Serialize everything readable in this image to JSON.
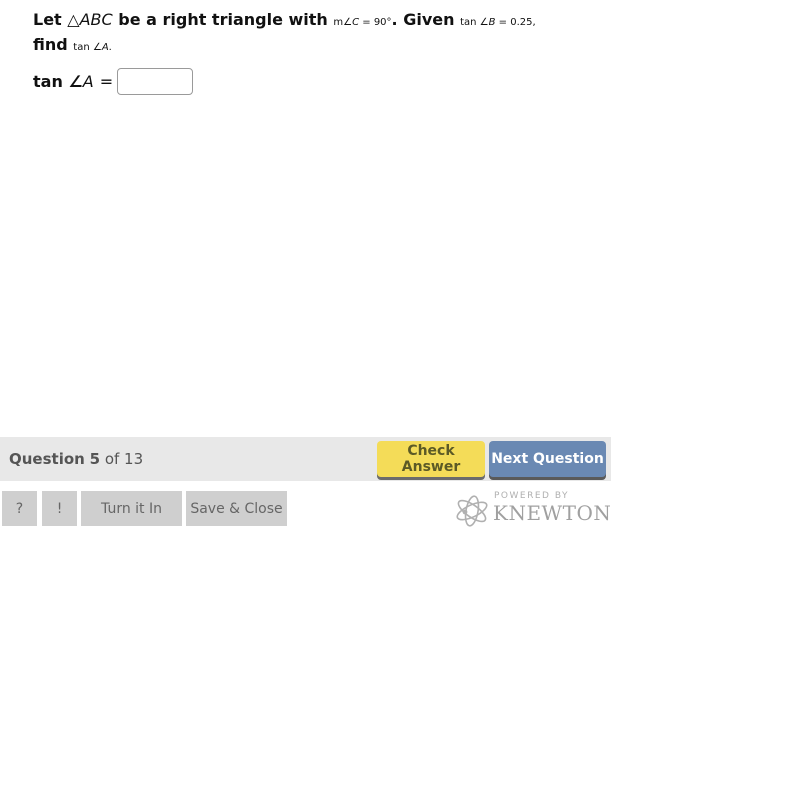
{
  "question": {
    "prefix": "Let ",
    "triangle_symbol": "△",
    "triangle_name": "ABC",
    "middle": " be a right triangle with ",
    "given_angle_prefix": "m∠",
    "given_angle_var": "C",
    "given_angle_value": " = 90°",
    "given_word": ". Given ",
    "tan_b_prefix": "tan ∠",
    "tan_b_var": "B",
    "tan_b_value": " = 0.25,",
    "find_word": "find ",
    "find_prefix": "tan ∠",
    "find_var": "A",
    "find_suffix": "."
  },
  "answer": {
    "label_prefix": "tan ∠",
    "label_var": "A",
    "equals": "=",
    "input_value": "",
    "input_placeholder": ""
  },
  "progress": {
    "word": "Question",
    "current": "5",
    "of_total": "of 13"
  },
  "buttons": {
    "check_answer": "Check Answer",
    "next_question": "Next Question",
    "help": "?",
    "report": "!",
    "turn_in": "Turn it In",
    "save_close": "Save & Close"
  },
  "branding": {
    "powered_by": "POWERED BY",
    "name": "KNEWTON",
    "icon": "atom-icon"
  },
  "colors": {
    "check_answer_bg": "#f4dc58",
    "next_question_bg": "#6a89b3",
    "progress_bar_bg": "#e8e8e8",
    "tool_button_bg": "#cfcfcf"
  }
}
